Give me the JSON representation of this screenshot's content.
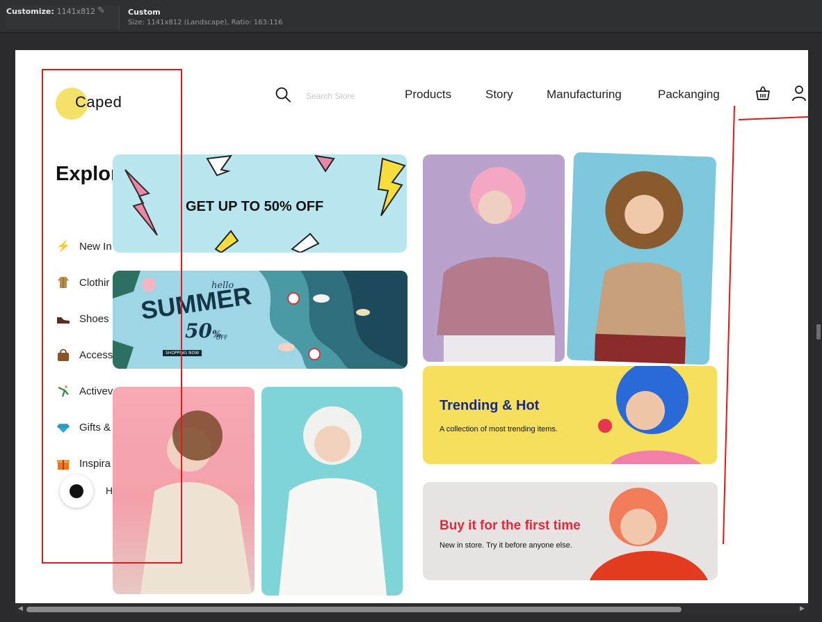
{
  "devtools": {
    "customize_label": "Customize:",
    "customize_size": "1141x812",
    "preset_title": "Custom",
    "preset_subtitle": "Size: 1141x812 (Landscape), Ratio: 163:116",
    "edit_icon": "pencil-icon"
  },
  "header": {
    "logo": "Caped",
    "search_placeholder": "Search Store",
    "nav": [
      "Products",
      "Story",
      "Manufacturing",
      "Packanging"
    ],
    "icons": [
      "search-icon",
      "basket-icon",
      "user-icon"
    ]
  },
  "sidebar": {
    "title": "Explor",
    "categories": [
      {
        "label": "New In",
        "icon": "lightning-icon"
      },
      {
        "label": "Clothir",
        "icon": "coat-icon"
      },
      {
        "label": "Shoes",
        "icon": "shoe-icon"
      },
      {
        "label": "Access",
        "icon": "handbag-icon"
      },
      {
        "label": "Activev",
        "icon": "gymnast-icon"
      },
      {
        "label": "Gifts &",
        "icon": "gem-icon"
      },
      {
        "label": "Inspira",
        "icon": "gift-icon"
      }
    ],
    "chat_label": "H"
  },
  "promos": {
    "sale": {
      "text": "GET UP TO 50% OFF"
    },
    "summer": {
      "hello": "hello",
      "big": "SUMMER",
      "pct": "50",
      "pct_sign": "%",
      "off": "OFF",
      "button": "SHOPPING NOW"
    },
    "trending": {
      "title": "Trending & Hot",
      "subtitle": "A collection of most trending items."
    },
    "first_time": {
      "title": "Buy it for the first time",
      "subtitle": "New in store. Try it before anyone else."
    }
  },
  "colors": {
    "accent_yellow": "#f5e06a",
    "annotation_red": "#e01919",
    "trend_bg": "#f6df5c",
    "buy_title": "#e22a3d"
  }
}
